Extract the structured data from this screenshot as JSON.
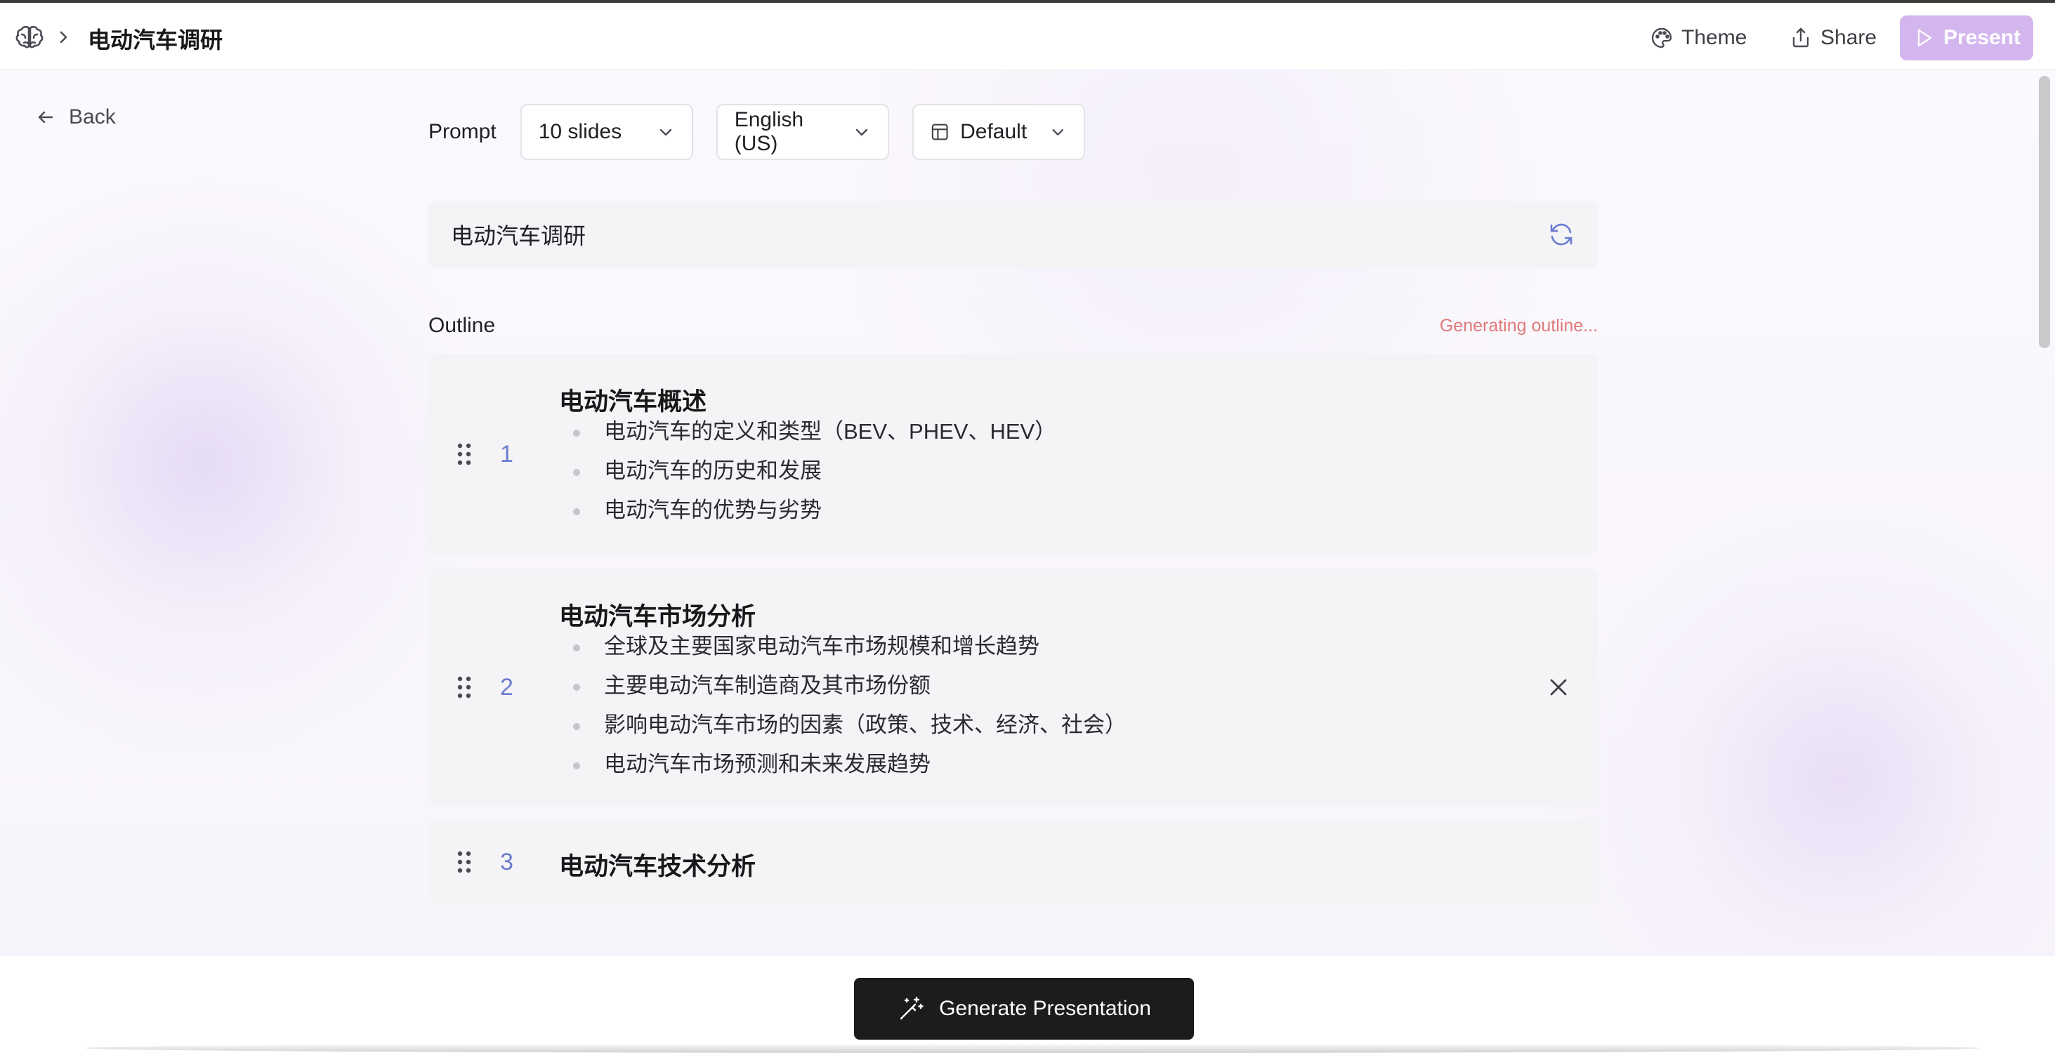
{
  "breadcrumb": {
    "icon": "brain-icon",
    "title": "电动汽车调研"
  },
  "toolbar": {
    "theme_label": "Theme",
    "share_label": "Share",
    "present_label": "Present"
  },
  "nav": {
    "back_label": "Back"
  },
  "controls": {
    "prompt_label": "Prompt",
    "slides_selected": "10 slides",
    "language_selected": "English (US)",
    "layout_selected": "Default"
  },
  "prompt": {
    "text": "电动汽车调研"
  },
  "outline": {
    "label": "Outline",
    "status": "Generating outline...",
    "slides": [
      {
        "number": "1",
        "title": "电动汽车概述",
        "bullets": [
          "电动汽车的定义和类型（BEV、PHEV、HEV）",
          "电动汽车的历史和发展",
          "电动汽车的优势与劣势"
        ]
      },
      {
        "number": "2",
        "title": "电动汽车市场分析",
        "bullets": [
          "全球及主要国家电动汽车市场规模和增长趋势",
          "主要电动汽车制造商及其市场份额",
          "影响电动汽车市场的因素（政策、技术、经济、社会）",
          "电动汽车市场预测和未来发展趋势"
        ]
      },
      {
        "number": "3",
        "title": "电动汽车技术分析",
        "bullets": []
      }
    ]
  },
  "footer": {
    "generate_label": "Generate Presentation"
  },
  "colors": {
    "accent_present": "#d3b6ee",
    "slide_number": "#6b7ccf",
    "status_text": "#e07a7a",
    "generate_button": "#1c1c1e"
  }
}
